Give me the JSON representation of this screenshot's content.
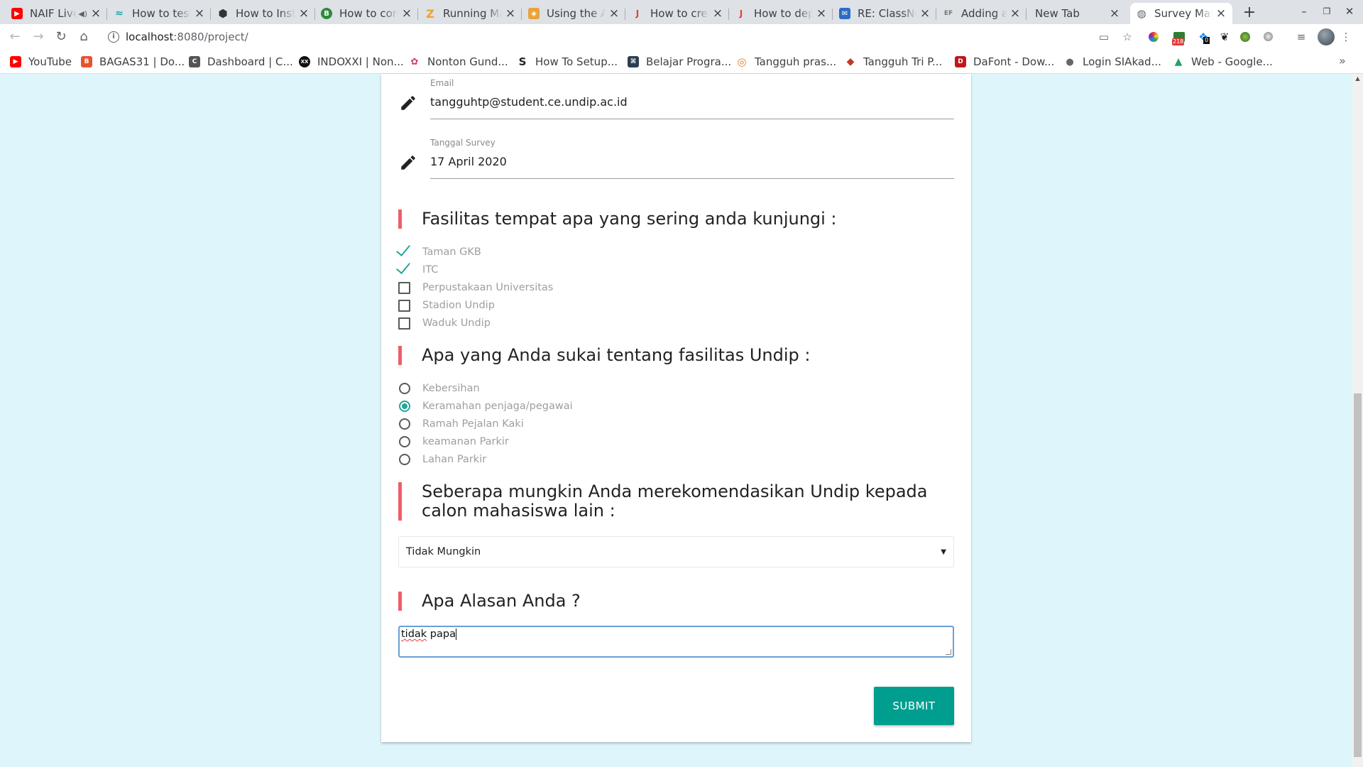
{
  "browser": {
    "tabs": [
      {
        "title": "NAIF Live",
        "favicon": "youtube-icon",
        "color": "#ff0000",
        "glyph": "▶",
        "audio": "🔈"
      },
      {
        "title": "How to test",
        "favicon": "wifi-icon",
        "color": "#1ba9a6",
        "glyph": "≈"
      },
      {
        "title": "How to Install",
        "favicon": "hexagon-icon",
        "color": "#333333",
        "glyph": "⬢"
      },
      {
        "title": "How to configure",
        "favicon": "b-icon",
        "color": "#2e8b3a",
        "glyph": "B"
      },
      {
        "title": "Running Magento",
        "favicon": "z-icon",
        "color": "#f0a030",
        "glyph": "Z"
      },
      {
        "title": "Using the API",
        "favicon": "cube-icon",
        "color": "#e8a33c",
        "glyph": "◈"
      },
      {
        "title": "How to create",
        "favicon": "jt-icon",
        "color": "#e0452f",
        "glyph": "J"
      },
      {
        "title": "How to deploy",
        "favicon": "jt-icon",
        "color": "#e0452f",
        "glyph": "J"
      },
      {
        "title": "RE: ClassNotFound",
        "favicon": "grid-icon",
        "color": "#2b6cc4",
        "glyph": "✉"
      },
      {
        "title": "Adding a Route",
        "favicon": "ef-icon",
        "color": "#777777",
        "glyph": "EF"
      },
      {
        "title": "New Tab",
        "favicon": "",
        "color": "",
        "glyph": ""
      },
      {
        "title": "Survey Mahasiswa",
        "favicon": "globe-icon",
        "color": "#5f6368",
        "glyph": "◍"
      }
    ],
    "new_tab": "+",
    "minimize": "–",
    "restore": "❐",
    "close": "✕",
    "url_host": "localhost",
    "url_path": ":8080/project/",
    "bookmarks": [
      {
        "label": "YouTube",
        "icon": "youtube-icon",
        "color": "#ff0000",
        "glyph": "▶"
      },
      {
        "label": "BAGAS31 | Do...",
        "icon": "bagas-icon",
        "color": "#e8532f",
        "glyph": "B"
      },
      {
        "label": "Dashboard | C...",
        "icon": "dashboard-icon",
        "color": "#555555",
        "glyph": "C"
      },
      {
        "label": "INDOXXI | Non...",
        "icon": "indoxxi-icon",
        "color": "#111111",
        "glyph": "XX"
      },
      {
        "label": "Nonton Gund...",
        "icon": "gundam-icon",
        "color": "#d33b5a",
        "glyph": "✿"
      },
      {
        "label": "How To Setup...",
        "icon": "s-icon",
        "color": "#222222",
        "glyph": "S"
      },
      {
        "label": "Belajar Progra...",
        "icon": "code-icon",
        "color": "#2c3e50",
        "glyph": "⌘"
      },
      {
        "label": "Tangguh pras...",
        "icon": "ring-icon",
        "color": "#e67e22",
        "glyph": "◎"
      },
      {
        "label": "Tangguh Tri P...",
        "icon": "gem-icon",
        "color": "#c0392b",
        "glyph": "◆"
      },
      {
        "label": "DaFont - Dow...",
        "icon": "dafont-icon",
        "color": "#c0171c",
        "glyph": "D"
      },
      {
        "label": "Login SIAkad...",
        "icon": "siakad-icon",
        "color": "#666666",
        "glyph": "●"
      },
      {
        "label": "Web - Google...",
        "icon": "drive-icon",
        "color": "#1fa463",
        "glyph": "▲"
      }
    ],
    "ext_badge": "218",
    "ext_badge2": "0"
  },
  "form": {
    "email_label": "Email",
    "email_value": "tangguhtp@student.ce.undip.ac.id",
    "date_label": "Tanggal Survey",
    "date_value": "17 April 2020",
    "q1": {
      "title": "Fasilitas tempat apa yang sering anda kunjungi :",
      "options": [
        {
          "label": "Taman GKB",
          "checked": true
        },
        {
          "label": "ITC",
          "checked": true
        },
        {
          "label": "Perpustakaan Universitas",
          "checked": false
        },
        {
          "label": "Stadion Undip",
          "checked": false
        },
        {
          "label": "Waduk Undip",
          "checked": false
        }
      ]
    },
    "q2": {
      "title": "Apa yang Anda sukai tentang fasilitas Undip :",
      "options": [
        {
          "label": "Kebersihan",
          "selected": false
        },
        {
          "label": "Keramahan penjaga/pegawai",
          "selected": true
        },
        {
          "label": "Ramah Pejalan Kaki",
          "selected": false
        },
        {
          "label": "keamanan Parkir",
          "selected": false
        },
        {
          "label": "Lahan Parkir",
          "selected": false
        }
      ]
    },
    "q3": {
      "title": "Seberapa mungkin Anda merekomendasikan Undip kepada calon mahasiswa lain :",
      "selected": "Tidak Mungkin"
    },
    "q4": {
      "title": "Apa Alasan Anda ?",
      "answer_word1": "tidak",
      "answer_rest": " papa"
    },
    "submit_label": "SUBMIT"
  },
  "colors": {
    "accent": "#26a69a",
    "submit": "#009e8f",
    "bar": "#ef5d6b",
    "page_bg": "#def6fb"
  }
}
